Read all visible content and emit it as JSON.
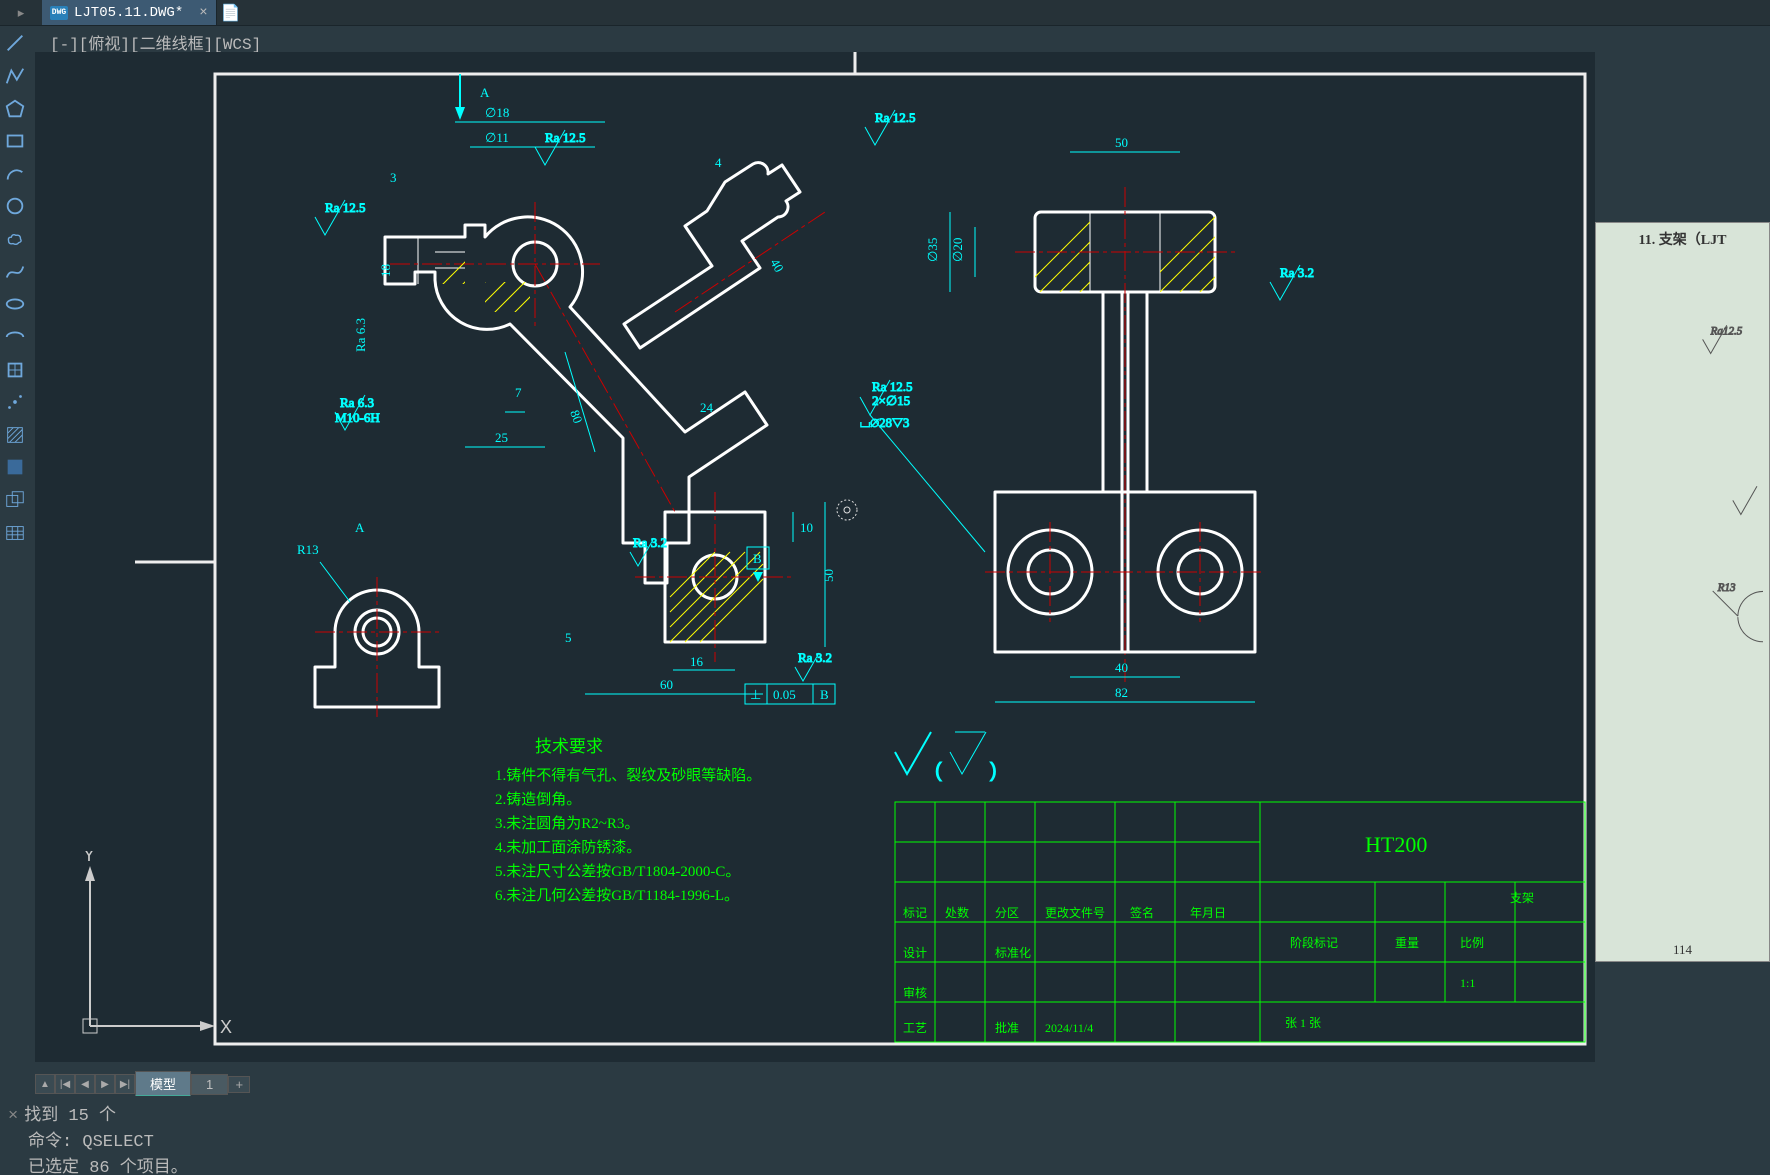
{
  "tab": {
    "filename": "LJT05.11.DWG*",
    "icon_label": "DWG"
  },
  "view_controls": "[-][俯视][二维线框][WCS]",
  "layout": {
    "model": "模型",
    "sheet1": "1"
  },
  "cmd": {
    "line1": "找到 15 个",
    "line2": "命令: QSELECT",
    "line3": "已选定 86 个项目。"
  },
  "preview": {
    "title": "11. 支架（LJT",
    "page": "114",
    "ra": "Ra12.5",
    "r13": "R13"
  },
  "ucs": {
    "x": "X",
    "y": "Y"
  },
  "dims": {
    "phi18": "∅18",
    "phi11": "∅11",
    "d3": "3",
    "d18": "18",
    "d7": "7",
    "d25": "25",
    "d60": "60",
    "d16": "16",
    "d4": "4",
    "d40r": "40",
    "d50r": "50",
    "d10": "10",
    "d5": "5",
    "d24": "24",
    "r13": "R13",
    "d50t": "50",
    "d82": "82",
    "d40b": "40",
    "phi35": "∅35",
    "phi20": "∅20",
    "ra125": "Ra 12.5",
    "ra63": "Ra 6.3",
    "ra32": "Ra 3.2",
    "m10": "M10-6H",
    "secA": "A",
    "datumB": "B",
    "hole": "2×∅15",
    "csink": "⌴∅28▽3",
    "r80": "80",
    "tol": "⊥ 0.05 B"
  },
  "notes": {
    "hdr": "技术要求",
    "n1": "1.铸件不得有气孔、裂纹及砂眼等缺陷。",
    "n2": "2.铸造倒角。",
    "n3": "3.未注圆角为R2~R3。",
    "n4": "4.未加工面涂防锈漆。",
    "n5": "5.未注尺寸公差按GB/T1804-2000-C。",
    "n6": "6.未注几何公差按GB/T1184-1996-L。"
  },
  "titleblock": {
    "material": "HT200",
    "name": "支架",
    "scale": "1:1",
    "date": "2024/11/4",
    "h_mark": "标记",
    "h_zone": "处数",
    "h_div": "分区",
    "h_file": "更改文件号",
    "h_sign": "签名",
    "h_date": "年月日",
    "h_des": "设计",
    "h_std": "标准化",
    "h_wt": "重量",
    "h_scl": "比例",
    "h_chk": "审核",
    "h_sheet": "张 1 张",
    "h_stage": "阶段标记",
    "h_appr": "工艺",
    "h_appr2": "批准"
  }
}
